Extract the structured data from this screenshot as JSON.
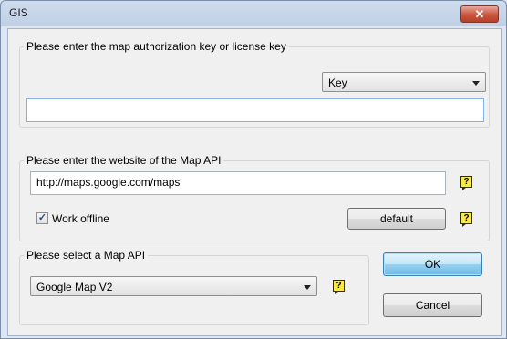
{
  "window": {
    "title": "GIS",
    "close_glyph": "✕"
  },
  "license": {
    "legend": "Please enter the map authorization key or license key",
    "type_select": "Key",
    "key_value": ""
  },
  "website": {
    "legend": "Please enter the website of the Map API",
    "url": "http://maps.google.com/maps",
    "offline_label": "Work offline",
    "offline_checked": true,
    "default_button": "default"
  },
  "api": {
    "legend": "Please select a Map API",
    "selected": "Google Map V2"
  },
  "buttons": {
    "ok": "OK",
    "cancel": "Cancel"
  },
  "help_glyph": "?",
  "check_glyph": "✓",
  "colors": {
    "help_bg": "#f7e84b",
    "ok_accent": "#3c7fb1",
    "close_bg": "#c9553e"
  }
}
